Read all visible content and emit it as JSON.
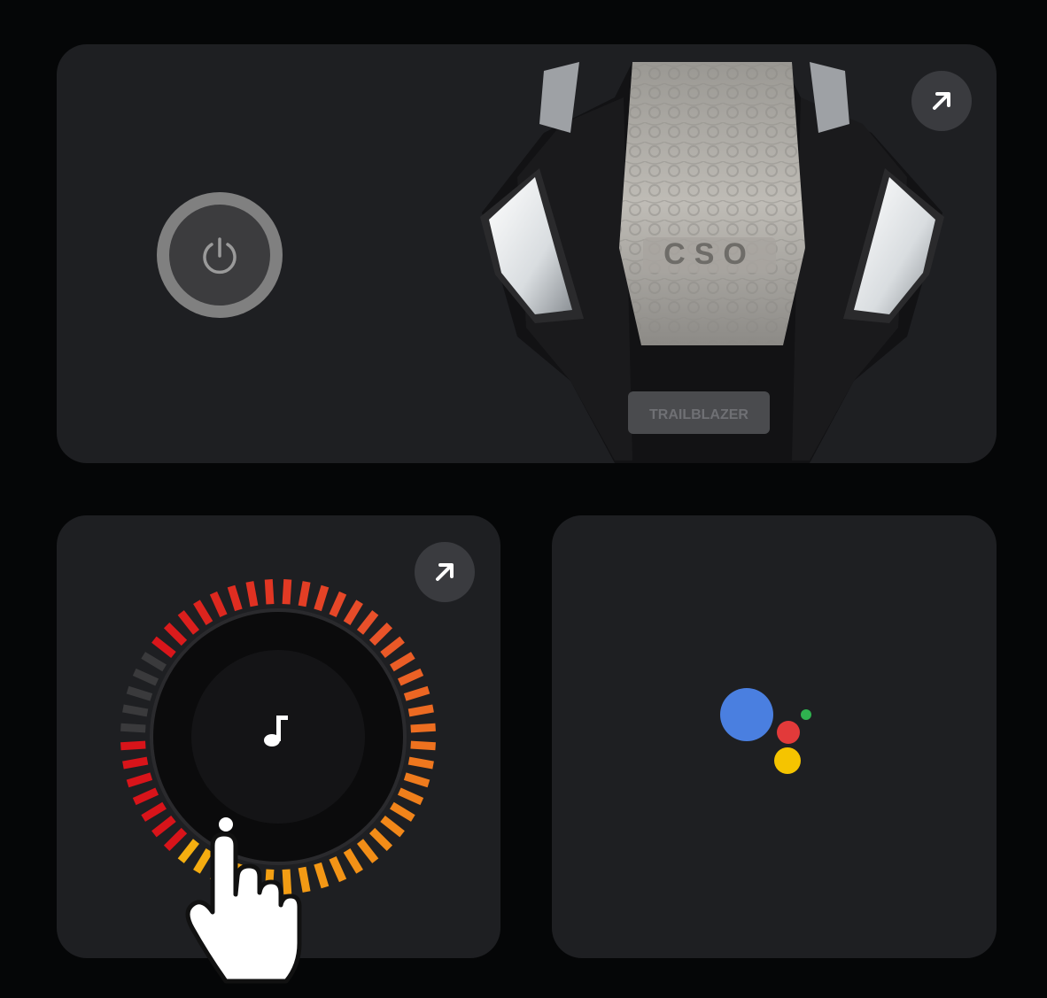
{
  "top_card": {
    "product_name_label": "TRAILBLAZER",
    "product_logo_text": "CSO",
    "icons": {
      "power": "power-icon",
      "expand": "arrow-up-right-icon"
    }
  },
  "volume_card": {
    "level_percent": 72,
    "icons": {
      "music": "music-note-icon",
      "expand": "arrow-up-right-icon"
    }
  },
  "assistant_card": {
    "icon": "google-assistant-icon",
    "colors": {
      "blue": "#4a7fe0",
      "red": "#e23a3a",
      "yellow": "#f5c400",
      "green": "#2fb24f"
    }
  },
  "colors": {
    "background": "#050607",
    "card": "#1e1f22",
    "meter_gradient": [
      "#d8141a",
      "#e8502a",
      "#f28a18",
      "#f5b20f"
    ]
  }
}
